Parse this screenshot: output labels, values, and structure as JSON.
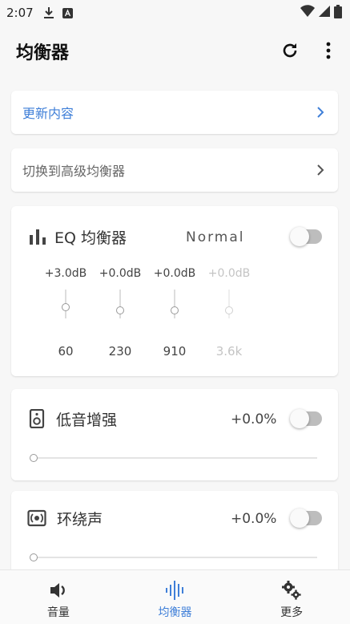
{
  "status_bar": {
    "time": "2:07"
  },
  "app_bar": {
    "title": "均衡器"
  },
  "update_card": {
    "label": "更新内容"
  },
  "advanced_card": {
    "label": "切换到高级均衡器"
  },
  "eq_section": {
    "title": "EQ 均衡器",
    "preset": "Normal",
    "enabled": false,
    "bands": [
      {
        "gain": "+3.0dB",
        "freq": "60",
        "enabled": true
      },
      {
        "gain": "+0.0dB",
        "freq": "230",
        "enabled": true
      },
      {
        "gain": "+0.0dB",
        "freq": "910",
        "enabled": true
      },
      {
        "gain": "+0.0dB",
        "freq": "3.6k",
        "enabled": false
      }
    ]
  },
  "bass_section": {
    "title": "低音增强",
    "value": "+0.0%",
    "enabled": false,
    "level": 0
  },
  "surround_section": {
    "title": "环绕声",
    "value": "+0.0%",
    "enabled": false,
    "level": 0
  },
  "bottom_nav": {
    "items": [
      {
        "label": "音量",
        "icon": "volume-icon"
      },
      {
        "label": "均衡器",
        "icon": "equalizer-icon"
      },
      {
        "label": "更多",
        "icon": "gears-icon"
      }
    ],
    "active_index": 1
  },
  "colors": {
    "accent": "#3f7fd8",
    "toggle_off": "#bdbdbd"
  }
}
